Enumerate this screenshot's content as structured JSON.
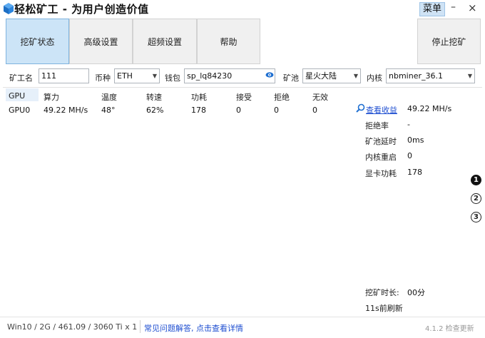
{
  "window": {
    "title": "轻松矿工 - 为用户创造价值",
    "menu_label": "菜单",
    "minimize_glyph": "–",
    "close_glyph": "×"
  },
  "toolbar": {
    "mining_status": "挖矿状态",
    "advanced_settings": "高级设置",
    "overclock_settings": "超频设置",
    "help": "帮助",
    "stop_mining": "停止挖矿"
  },
  "form": {
    "miner_name_label": "矿工名",
    "miner_name_value": "111",
    "coin_label": "币种",
    "coin_value": "ETH",
    "wallet_label": "钱包",
    "wallet_value": "sp_lq84230",
    "pool_label": "矿池",
    "pool_value": "星火大陆",
    "kernel_label": "内核",
    "kernel_value": "nbminer_36.1"
  },
  "gpu_table": {
    "headers": [
      "GPU",
      "算力",
      "温度",
      "转速",
      "功耗",
      "接受",
      "拒绝",
      "无效"
    ],
    "rows": [
      [
        "GPU0",
        "49.22 MH/s",
        "48°",
        "62%",
        "178",
        "0",
        "0",
        "0"
      ]
    ]
  },
  "stats": {
    "view_earnings": "查看收益",
    "hashrate": "49.22 MH/s",
    "reject_rate_label": "拒绝率",
    "reject_rate_value": "-",
    "pool_latency_label": "矿池延时",
    "pool_latency_value": "0ms",
    "kernel_restart_label": "内核重启",
    "kernel_restart_value": "0",
    "gpu_power_label": "显卡功耗",
    "gpu_power_value": "178",
    "mining_duration_label": "挖矿时长:",
    "mining_duration_value": "00分",
    "refresh_text": "11s前刷新"
  },
  "pages": [
    "1",
    "2",
    "3"
  ],
  "footer": {
    "system_info": "Win10  / 2G / 461.09 / 3060 Ti x 1",
    "faq_link": "常见问题解答, 点击查看详情",
    "right_text": "4.1.2 检查更新"
  },
  "colors": {
    "active_tab": "#cce4f7",
    "link": "#1f4fd1",
    "menu_highlight": "#cfe3f5"
  }
}
